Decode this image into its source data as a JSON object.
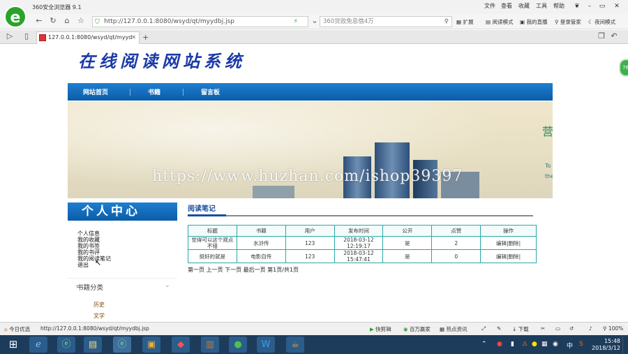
{
  "browser": {
    "app_title": "360安全浏览器 9.1",
    "title_menu": [
      "文件",
      "查看",
      "收藏",
      "工具",
      "帮助"
    ],
    "url": "http://127.0.0.1:8080/wsyd/qt/myydbj.jsp",
    "search_placeholder": "360贷款免息借4万",
    "toolbar": [
      "扩展",
      "阅读模式",
      "我的直播",
      "登录管家",
      "夜间模式"
    ],
    "tab_title": "127.0.0.1:8080/wsyd/qt/myyd",
    "tab_add": "+",
    "logo_glyph": "e",
    "greenball_text": "76"
  },
  "site": {
    "title": "在线阅读网站系统",
    "nav": [
      "网站首页",
      "书籍",
      "留言板"
    ],
    "banner_text_1": "营",
    "banner_text_2": "To",
    "banner_text_3": "the",
    "watermark": "https://www.huzhan.com/ishop39397"
  },
  "sidebar": {
    "heading": "个人中心",
    "links": [
      "个人信息",
      "我的收藏",
      "我的书签",
      "我的书评",
      "我的阅读笔记",
      "退出"
    ],
    "category_heading": "书籍分类",
    "categories": [
      "历史",
      "文学"
    ]
  },
  "main": {
    "section_title": "阅读笔记",
    "table_headers": [
      "标题",
      "书籍",
      "用户",
      "发布时间",
      "公开",
      "点赞",
      "操作"
    ],
    "rows": [
      {
        "title": "觉得可以这个观点不错",
        "book": "水浒传",
        "user": "123",
        "date": "2018-03-12",
        "time": "12:19:17",
        "public": "是",
        "likes": "2",
        "edit": "编辑",
        "sep": "|",
        "delete": "删除",
        "sep2": "|"
      },
      {
        "title": "挺好的就是",
        "book": "电影自传",
        "user": "123",
        "date": "2018-03-12",
        "time": "15:47:41",
        "public": "是",
        "likes": "0",
        "edit": "编辑",
        "sep": "|",
        "delete": "删除",
        "sep2": "|"
      }
    ],
    "pager": "第一页 上一页 下一页 最后一页 第1页/共1页"
  },
  "statusbar": {
    "left_label": "今日优选",
    "url": "http://127.0.0.1:8080/wsyd/qt/myydbj.jsp",
    "items": [
      "快剪辑",
      "百万赢家",
      "热点资讯",
      "下载"
    ],
    "zoom": "100%"
  },
  "taskbar": {
    "time": "15:48",
    "date": "2018/3/12",
    "tray_ime": "中"
  },
  "colors": {
    "nav_blue": "#0a5ca8",
    "title_blue": "#1a3aa8",
    "table_border": "#2aa8a8",
    "browser_green": "#2aa32a"
  }
}
